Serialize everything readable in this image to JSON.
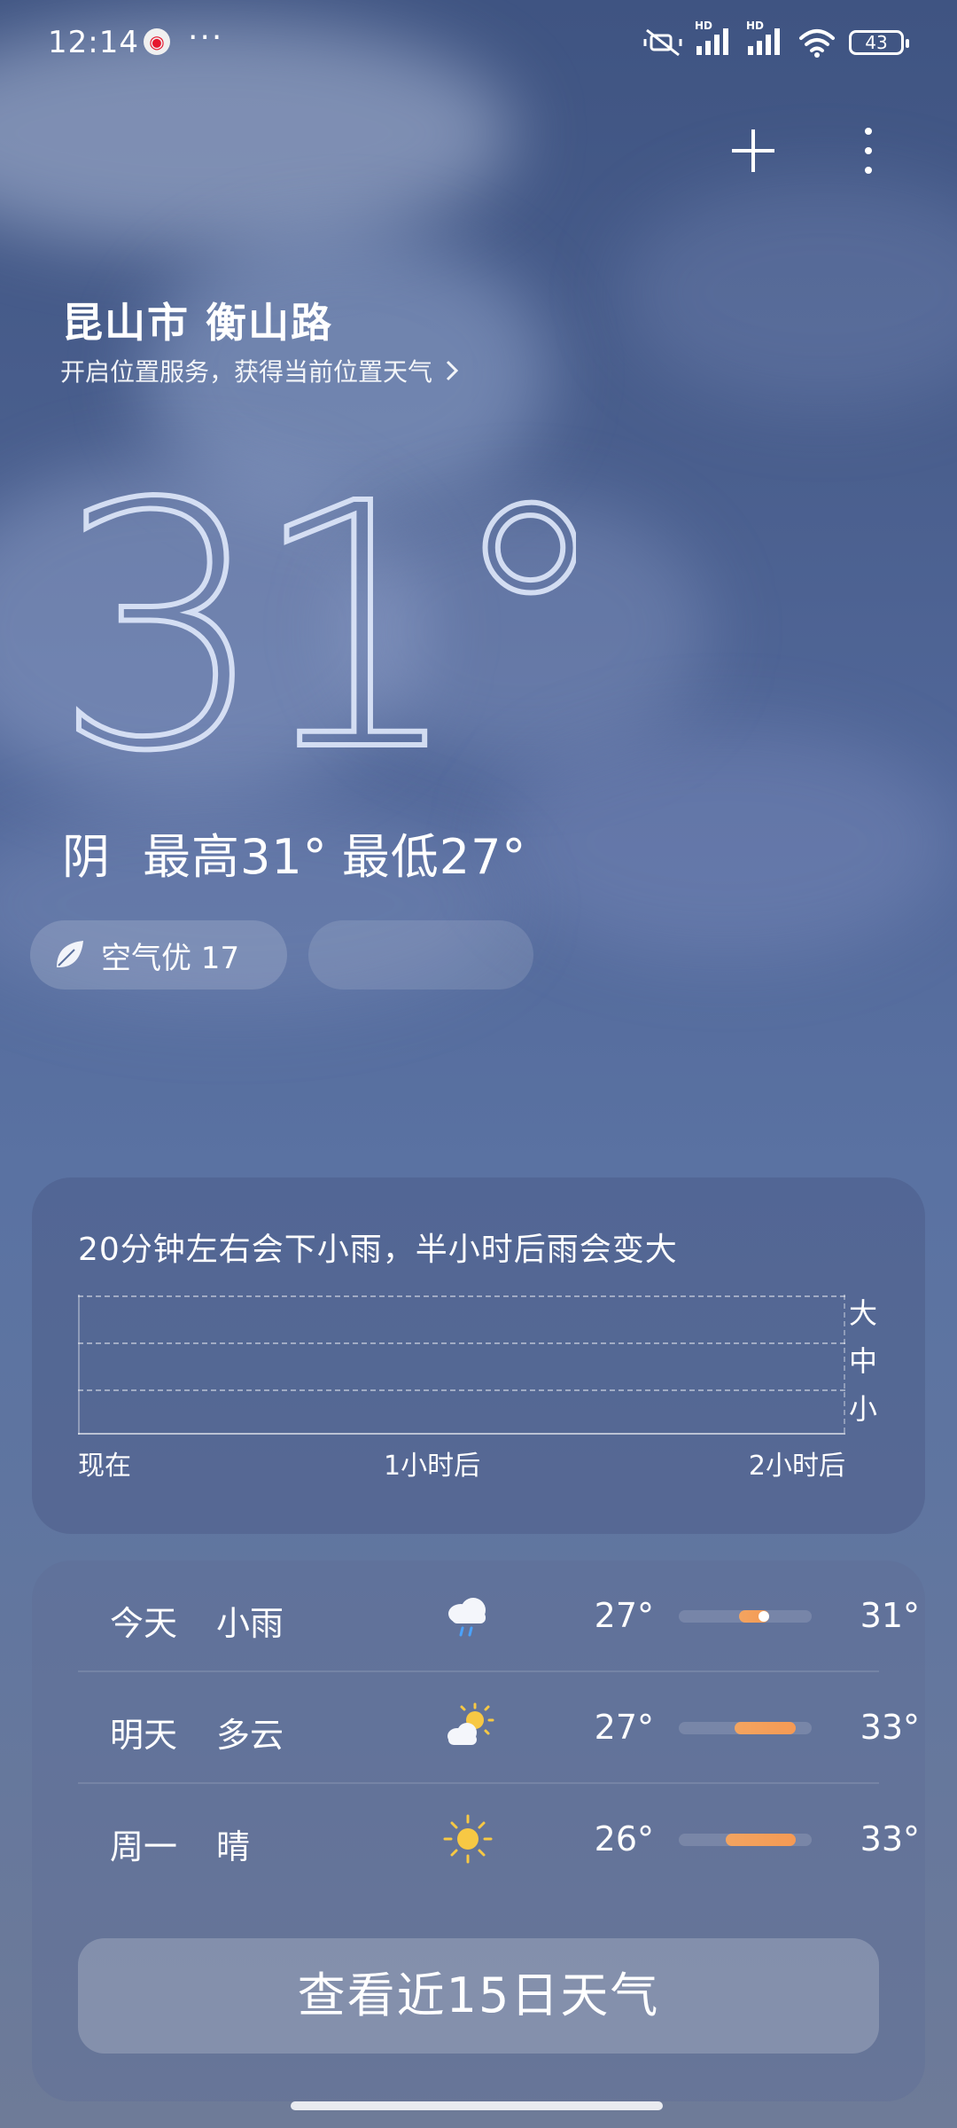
{
  "status_bar": {
    "time": "12:14",
    "notification_dots": "···",
    "signal_labels": [
      "HD",
      "HD"
    ],
    "battery": "43"
  },
  "location": {
    "name": "昆山市 衡山路",
    "hint": "开启位置服务，获得当前位置天气"
  },
  "current": {
    "temperature": "31°",
    "condition": "阴",
    "high": "最高31°",
    "low": "最低27°"
  },
  "chips": {
    "air_quality": "空气优 17"
  },
  "rain_card": {
    "title": "20分钟左右会下小雨，半小时后雨会变大",
    "x_labels": [
      "现在",
      "1小时后",
      "2小时后"
    ],
    "y_labels": [
      "大",
      "中",
      "小"
    ]
  },
  "forecast": [
    {
      "day": "今天",
      "condition": "小雨",
      "icon": "rain-cloud-icon",
      "low": "27°",
      "high": "31°",
      "bar_start": 0.45,
      "bar_end": 0.68,
      "current_marker": 0.64
    },
    {
      "day": "明天",
      "condition": "多云",
      "icon": "partly-cloudy-icon",
      "low": "27°",
      "high": "33°",
      "bar_start": 0.42,
      "bar_end": 0.88
    },
    {
      "day": "周一",
      "condition": "晴",
      "icon": "sun-icon",
      "low": "26°",
      "high": "33°",
      "bar_start": 0.35,
      "bar_end": 0.88
    }
  ],
  "forecast_button": "查看近15日天气",
  "colors": {
    "bar_fill": "#f59a54",
    "marker": "#ffffff"
  }
}
